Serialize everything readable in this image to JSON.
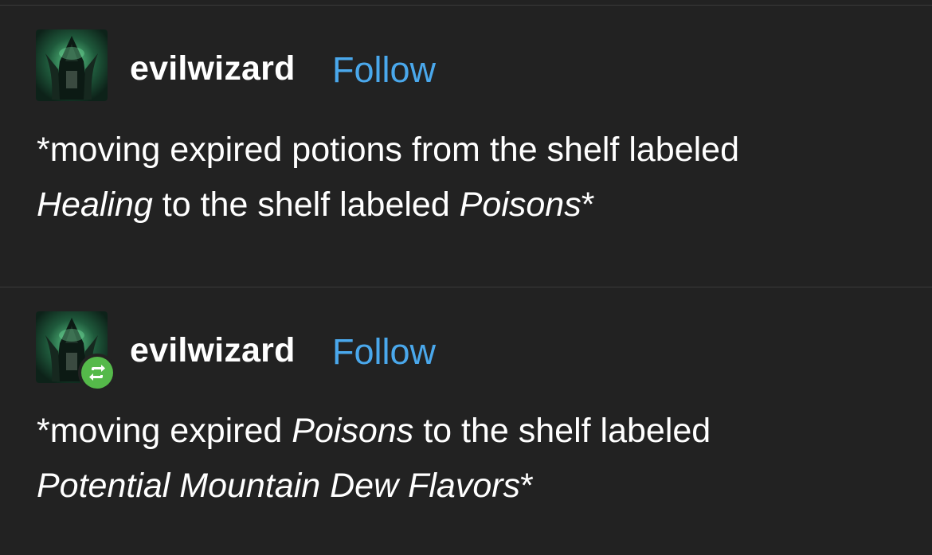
{
  "posts": [
    {
      "username": "evilwizard",
      "follow_label": "Follow",
      "reblogged": false,
      "body": {
        "line1_prefix": "*moving expired potions from the shelf labeled",
        "line2_italic_a": "Healing",
        "line2_middle": " to the shelf labeled ",
        "line2_italic_b": "Poisons",
        "line2_suffix": "*"
      }
    },
    {
      "username": "evilwizard",
      "follow_label": "Follow",
      "reblogged": true,
      "body": {
        "line1_prefix": "*moving expired ",
        "line1_italic": "Poisons",
        "line1_suffix": " to the shelf labeled",
        "line2_italic": "Potential Mountain Dew Flavors",
        "line2_suffix": "*"
      }
    }
  ],
  "colors": {
    "background": "#222222",
    "text": "#ffffff",
    "follow": "#4aa8ec",
    "reblog_badge": "#55b94a",
    "divider": "#3a3a3a"
  },
  "icons": {
    "avatar": "hooded-wizard-avatar",
    "reblog": "reblog-icon"
  }
}
